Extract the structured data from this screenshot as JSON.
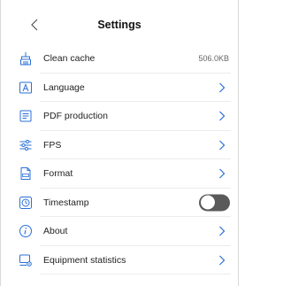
{
  "header": {
    "title": "Settings",
    "back_icon": "chevron-left-icon"
  },
  "settings": {
    "clean_cache": {
      "label": "Clean cache",
      "value": "506.0KB",
      "icon": "broom-icon"
    },
    "language": {
      "label": "Language",
      "icon": "letter-a-icon"
    },
    "pdf_production": {
      "label": "PDF production",
      "icon": "document-icon"
    },
    "fps": {
      "label": "FPS",
      "icon": "sliders-icon"
    },
    "format": {
      "label": "Format",
      "icon": "file-format-icon"
    },
    "timestamp": {
      "label": "Timestamp",
      "icon": "clock-icon",
      "enabled": false
    },
    "about": {
      "label": "About",
      "icon": "info-icon"
    },
    "equipment_statistics": {
      "label": "Equipment statistics",
      "icon": "device-settings-icon"
    }
  },
  "colors": {
    "icon_blue": "#2a6fd6",
    "toggle_off": "#5a5a5a",
    "chevron": "#2a6fd6"
  }
}
